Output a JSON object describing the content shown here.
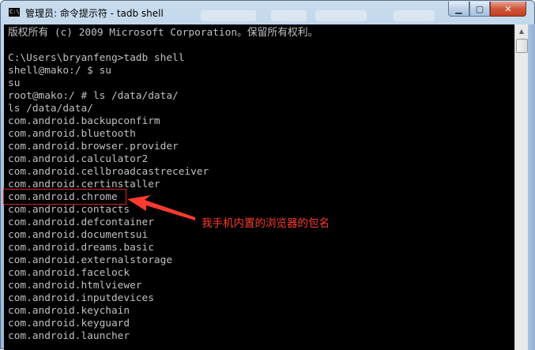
{
  "window": {
    "title": "管理员: 命令提示符 - tadb  shell",
    "icon": "cmd-icon",
    "controls": {
      "minimize": "▁",
      "maximize": "▢",
      "close": "✕"
    }
  },
  "console": {
    "lines": [
      "版权所有 (c) 2009 Microsoft Corporation。保留所有权利。",
      "",
      "C:\\Users\\bryanfeng>tadb shell",
      "shell@mako:/ $ su",
      "su",
      "root@mako:/ # ls /data/data/",
      "ls /data/data/",
      "com.android.backupconfirm",
      "com.android.bluetooth",
      "com.android.browser.provider",
      "com.android.calculator2",
      "com.android.cellbroadcastreceiver",
      "com.android.certinstaller",
      "com.android.chrome",
      "com.android.contacts",
      "com.android.defcontainer",
      "com.android.documentsui",
      "com.android.dreams.basic",
      "com.android.externalstorage",
      "com.android.facelock",
      "com.android.htmlviewer",
      "com.android.inputdevices",
      "com.android.keychain",
      "com.android.keyguard",
      "com.android.launcher"
    ]
  },
  "scrollbar": {
    "up_arrow": "▲"
  },
  "annotation": {
    "text": "我手机内置的浏览器的包名",
    "color": "#ff3b30"
  }
}
